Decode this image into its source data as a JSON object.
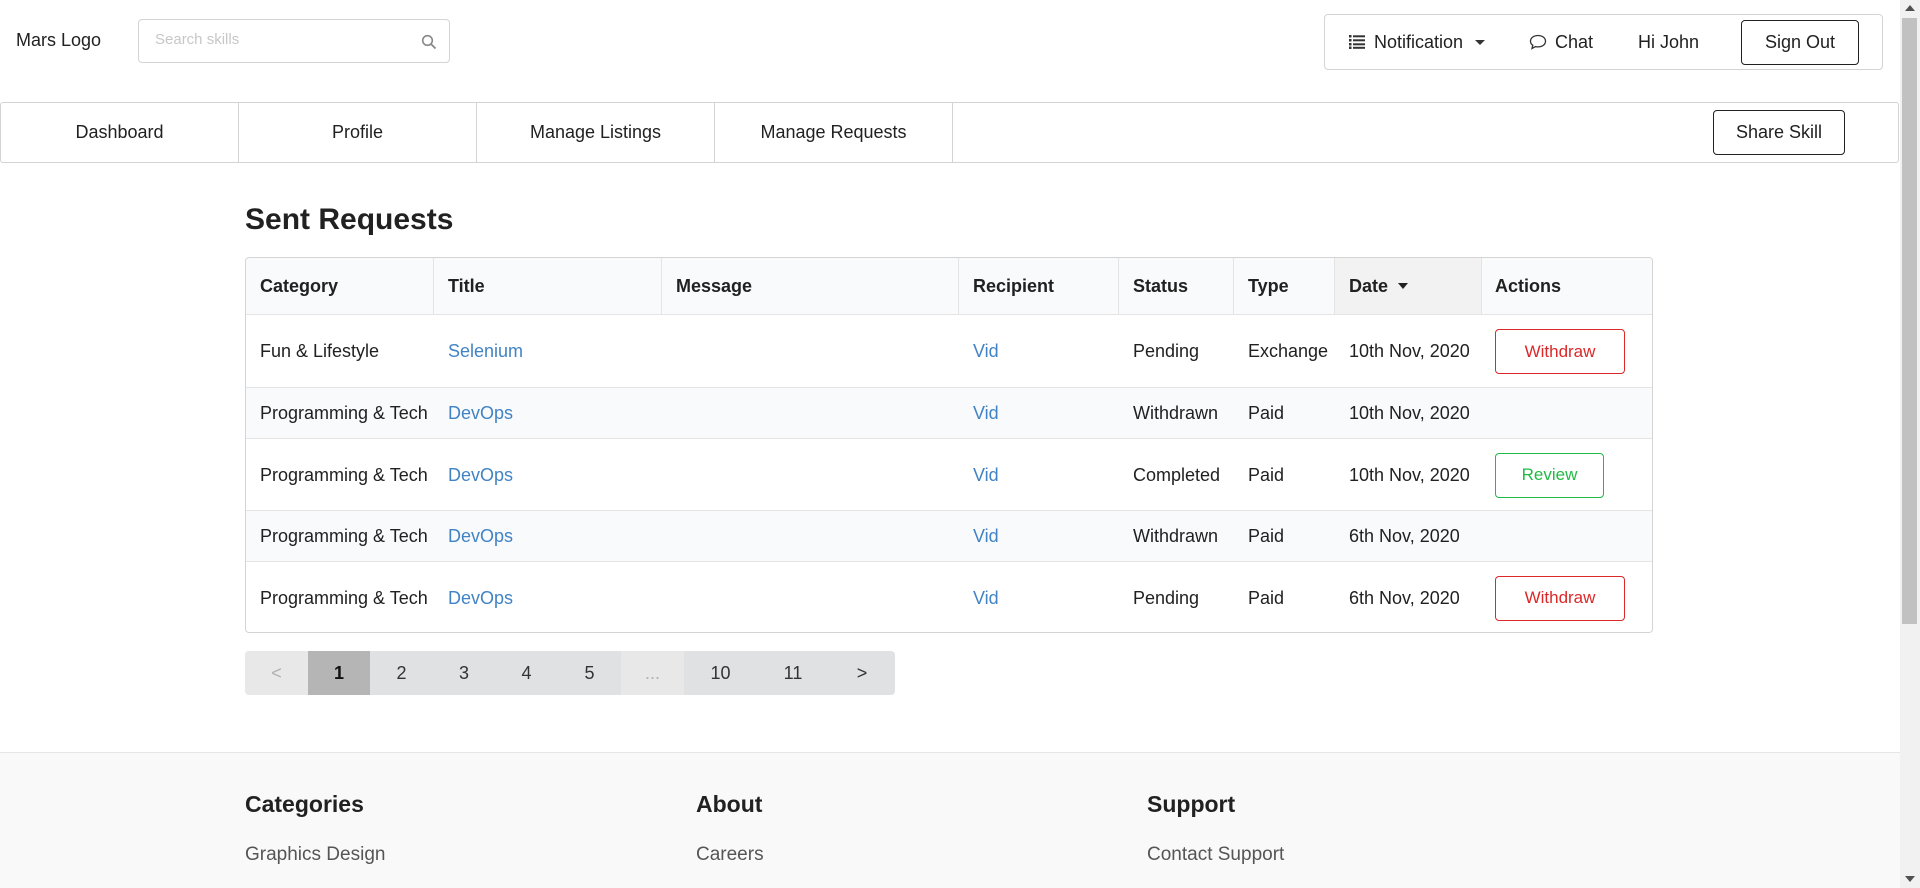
{
  "header": {
    "logo": "Mars Logo",
    "search_placeholder": "Search skills",
    "notification_label": "Notification",
    "chat_label": "Chat",
    "greeting": "Hi John",
    "signout_label": "Sign Out"
  },
  "nav": {
    "tabs": [
      "Dashboard",
      "Profile",
      "Manage Listings",
      "Manage Requests"
    ],
    "share_label": "Share Skill"
  },
  "main": {
    "heading": "Sent Requests",
    "columns": [
      "Category",
      "Title",
      "Message",
      "Recipient",
      "Status",
      "Type",
      "Date",
      "Actions"
    ],
    "rows": [
      {
        "category": "Fun & Lifestyle",
        "title": "Selenium",
        "message": "",
        "recipient": "Vid",
        "status": "Pending",
        "type": "Exchange",
        "date": "10th Nov, 2020",
        "action": "Withdraw"
      },
      {
        "category": "Programming & Tech",
        "title": "DevOps",
        "message": "",
        "recipient": "Vid",
        "status": "Withdrawn",
        "type": "Paid",
        "date": "10th Nov, 2020",
        "action": ""
      },
      {
        "category": "Programming & Tech",
        "title": "DevOps",
        "message": "",
        "recipient": "Vid",
        "status": "Completed",
        "type": "Paid",
        "date": "10th Nov, 2020",
        "action": "Review"
      },
      {
        "category": "Programming & Tech",
        "title": "DevOps",
        "message": "",
        "recipient": "Vid",
        "status": "Withdrawn",
        "type": "Paid",
        "date": "6th Nov, 2020",
        "action": ""
      },
      {
        "category": "Programming & Tech",
        "title": "DevOps",
        "message": "",
        "recipient": "Vid",
        "status": "Pending",
        "type": "Paid",
        "date": "6th Nov, 2020",
        "action": "Withdraw"
      }
    ]
  },
  "pagination": {
    "items": [
      "<",
      "1",
      "2",
      "3",
      "4",
      "5",
      "...",
      "10",
      "11",
      ">"
    ],
    "current": "1"
  },
  "footer": {
    "columns": [
      {
        "heading": "Categories",
        "link": "Graphics Design"
      },
      {
        "heading": "About",
        "link": "Careers"
      },
      {
        "heading": "Support",
        "link": "Contact Support"
      }
    ]
  },
  "colors": {
    "link": "#4183c4",
    "withdraw": "#db2828",
    "review": "#21ba45",
    "active_page": "#b5b5b5"
  }
}
